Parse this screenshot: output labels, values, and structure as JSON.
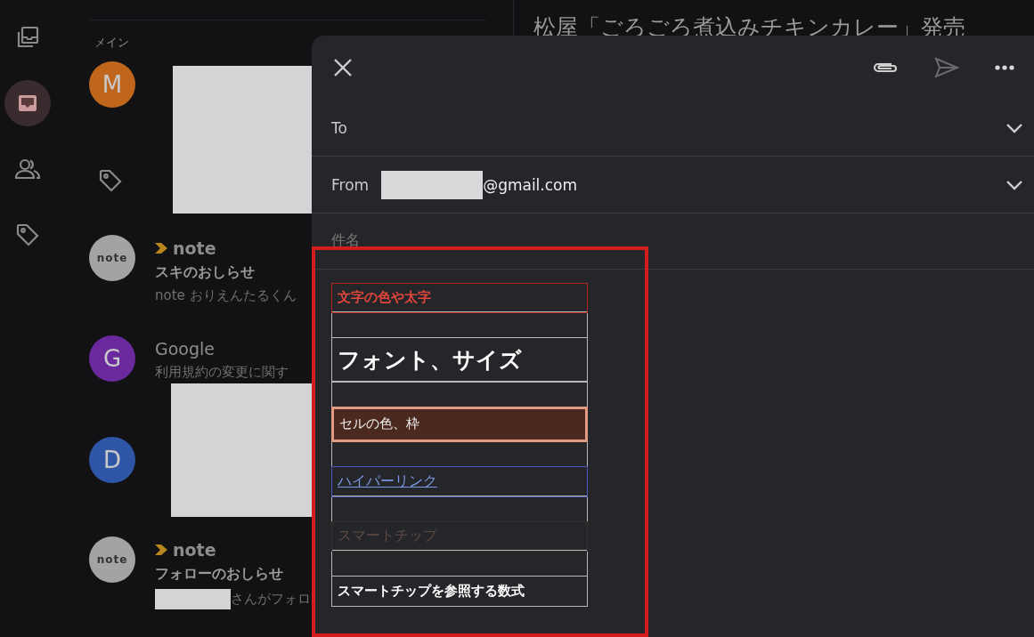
{
  "rail": {
    "items": [
      {
        "kind": "stack",
        "selected": false
      },
      {
        "kind": "inbox",
        "selected": true
      },
      {
        "kind": "people",
        "selected": false
      },
      {
        "kind": "tag",
        "selected": false
      }
    ]
  },
  "list": {
    "heading": "メイン",
    "items": [
      {
        "avatar": "M",
        "color": "#c0651c",
        "redacted": true
      },
      {
        "avatar": "note",
        "color": "#a3a3a3",
        "sender": "note",
        "subject": "スキのおしらせ",
        "preview": "note おりえんたるくん",
        "redacted": false
      },
      {
        "avatar": "G",
        "color": "#6a2a9e",
        "sender": "Google",
        "preview": "利用規約の変更に関す",
        "redacted": false
      },
      {
        "avatar": "D",
        "color": "#2f56a6",
        "redacted": true
      },
      {
        "avatar": "note",
        "color": "#a3a3a3",
        "sender": "note",
        "subject": "フォローのおしらせ",
        "preview": "さんがフォロ",
        "redacted": true
      }
    ]
  },
  "reading_pane": {
    "title": "松屋「ごろごろ煮込みチキンカレー」発売"
  },
  "compose": {
    "to": {
      "label": "To"
    },
    "from": {
      "label": "From",
      "value": "@gmail.com"
    },
    "subject": {
      "placeholder": "件名"
    },
    "table": [
      {
        "kind": "colored",
        "text": "文字の色や太字"
      },
      {
        "kind": "empty"
      },
      {
        "kind": "serif",
        "text": "フォント、サイズ"
      },
      {
        "kind": "empty"
      },
      {
        "kind": "filled",
        "text": "セルの色、枠"
      },
      {
        "kind": "empty"
      },
      {
        "kind": "link",
        "text": "ハイパーリンク"
      },
      {
        "kind": "empty"
      },
      {
        "kind": "chip",
        "text": "スマートチップ"
      },
      {
        "kind": "empty"
      },
      {
        "kind": "bold",
        "text": "スマートチップを参照する数式"
      }
    ]
  }
}
